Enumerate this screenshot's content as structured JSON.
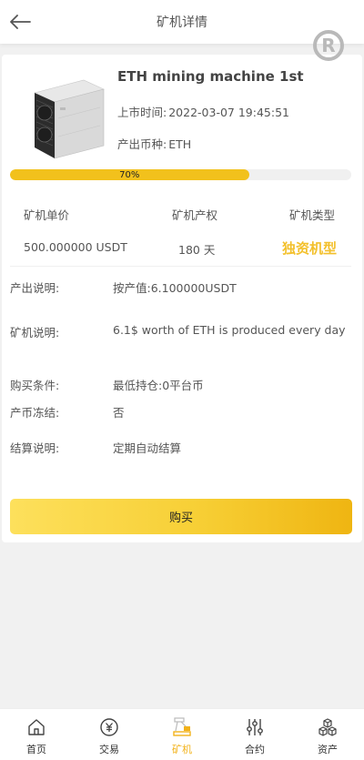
{
  "header": {
    "title": "矿机详情",
    "back_icon": "arrow-left-icon"
  },
  "watermark": {
    "text": "R"
  },
  "product": {
    "name": "ETH mining machine 1st",
    "launch_label": "上市时间:",
    "launch_value": "2022-03-07 19:45:51",
    "coin_label": "产出币种:",
    "coin_value": "ETH"
  },
  "progress": {
    "percent": 70,
    "label": "70%"
  },
  "stats": {
    "price_label": "矿机单价",
    "price_value": "500.000000 USDT",
    "term_label": "矿机产权",
    "term_value": "180 天",
    "type_label": "矿机类型",
    "type_value": "独资机型"
  },
  "details": {
    "output_label": "产出说明:",
    "output_value": "按产值:6.100000USDT",
    "desc_label": "矿机说明:",
    "desc_value": "6.1$ worth of ETH is produced every day",
    "condition_label": "购买条件:",
    "condition_value": "最低持仓:0平台币",
    "freeze_label": "产币冻结:",
    "freeze_value": "否",
    "settle_label": "结算说明:",
    "settle_value": "定期自动结算"
  },
  "buy_button": {
    "label": "购买"
  },
  "colors": {
    "accent": "#f2c11c",
    "accent_text": "#f3c02b",
    "active_tab": "#f2b21a"
  },
  "tabbar": [
    {
      "label": "首页",
      "icon": "home-icon",
      "active": false
    },
    {
      "label": "交易",
      "icon": "yuan-coin-icon",
      "active": false
    },
    {
      "label": "矿机",
      "icon": "mining-machine-icon",
      "active": true
    },
    {
      "label": "合约",
      "icon": "sliders-icon",
      "active": false
    },
    {
      "label": "资产",
      "icon": "cubes-icon",
      "active": false
    }
  ]
}
